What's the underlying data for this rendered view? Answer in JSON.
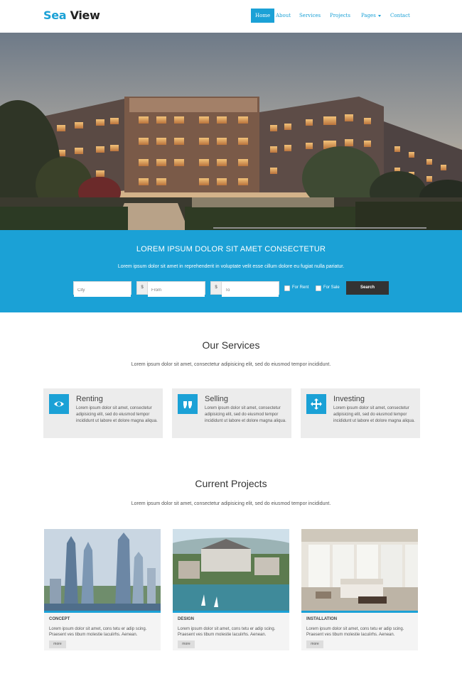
{
  "brand": {
    "part1": "Sea",
    "part2": "View"
  },
  "nav": {
    "items": [
      "Home",
      "About",
      "Services",
      "Projects",
      "Pages",
      "Contact"
    ],
    "active": "Home"
  },
  "search": {
    "title": "LOREM IPSUM DOLOR SIT AMET CONSECTETUR",
    "subtitle": "Lorem ipsum dolor sit amet in reprehenderit in voluptate velit esse cillum dolore eu fugiat nulla pariatur.",
    "city_placeholder": "City",
    "currency_symbol": "$",
    "from_placeholder": "From",
    "to_placeholder": "To",
    "for_rent_label": "For Rent",
    "for_sale_label": "For Sale",
    "button_label": "Search"
  },
  "services": {
    "title": "Our Services",
    "subtitle": "Lorem ipsum dolor sit amet, consectetur adipisicing elit, sed do eiusmod tempor incididunt.",
    "items": [
      {
        "title": "Renting",
        "icon": "eye-icon",
        "text": "Lorem ipsum dolor sit amet, consectetur adipisicing elit, sed do eiusmod tempor incididunt ut labore et dolore magna aliqua."
      },
      {
        "title": "Selling",
        "icon": "quote-icon",
        "text": "Lorem ipsum dolor sit amet, consectetur adipisicing elit, sed do eiusmod tempor incididunt ut labore et dolore magna aliqua."
      },
      {
        "title": "Investing",
        "icon": "move-arrows-icon",
        "text": "Lorem ipsum dolor sit amet, consectetur adipisicing elit, sed do eiusmod tempor incididunt ut labore et dolore magna aliqua."
      }
    ]
  },
  "projects": {
    "title": "Current Projects",
    "subtitle": "Lorem ipsum dolor sit amet, consectetur adipisicing elit, sed do eiusmod tempor incididunt.",
    "items": [
      {
        "label": "CONCEPT",
        "text": "Lorem ipsum dolor sit amet, cons tetu er adip scing. Praesent ves tibum molestie lacuiirhs. Aenean.",
        "more": "more"
      },
      {
        "label": "DESIGN",
        "text": "Lorem ipsum dolor sit amet, cons tetu er adip scing. Praesent ves tibum molestie lacuiirhs. Aenean.",
        "more": "more"
      },
      {
        "label": "INSTALLATION",
        "text": "Lorem ipsum dolor sit amet, cons tetu er adip scing. Praesent ves tibum molestie lacuiirhs. Aenean.",
        "more": "more"
      }
    ]
  },
  "colors": {
    "accent": "#1ba1d6",
    "dark": "#333333",
    "card": "#ececec"
  }
}
